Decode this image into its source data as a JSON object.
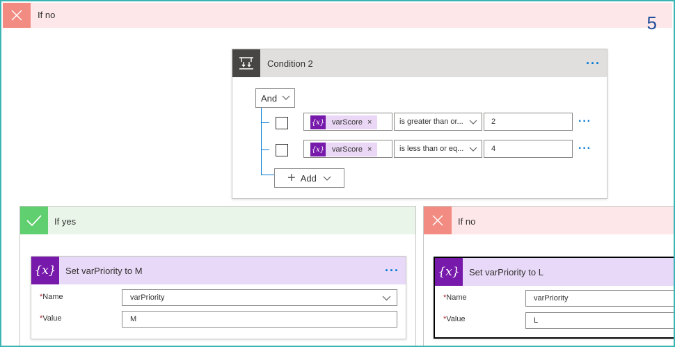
{
  "top_branch": {
    "label": "If no"
  },
  "step_number": "5",
  "condition": {
    "title": "Condition 2",
    "group_operator": "And",
    "rows": [
      {
        "token_icon": "{x}",
        "token": "varScore",
        "remove": "×",
        "operator": "is greater than or...",
        "value": "2"
      },
      {
        "token_icon": "{x}",
        "token": "varScore",
        "remove": "×",
        "operator": "is less than or eq...",
        "value": "4"
      }
    ],
    "add_label": "Add"
  },
  "yes_branch": {
    "label": "If yes",
    "action": {
      "icon": "{x}",
      "title": "Set varPriority to M",
      "name_label": "Name",
      "name_value": "varPriority",
      "value_label": "Value",
      "value_value": "M"
    }
  },
  "no_branch": {
    "label": "If no",
    "action": {
      "icon": "{x}",
      "title": "Set varPriority to L",
      "name_label": "Name",
      "name_value": "varPriority",
      "value_label": "Value",
      "value_value": "L"
    }
  },
  "required_marker": "*",
  "more_menu": "···",
  "colors": {
    "no_banner": "#fde7e9",
    "no_icon": "#f28b82",
    "yes_banner": "#e9f5e9",
    "yes_icon": "#5fcf6f",
    "variable_purple": "#7719aa",
    "accent_blue": "#0078d4"
  }
}
